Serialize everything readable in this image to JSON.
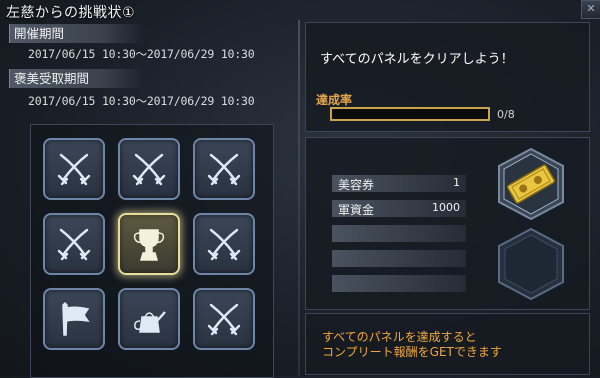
{
  "window": {
    "title": "左慈からの挑戦状①",
    "close_label": "✕"
  },
  "event_period": {
    "label": "開催期間",
    "dates": "2017/06/15 10:30～2017/06/29 10:30"
  },
  "reward_period": {
    "label": "褒美受取期間",
    "dates": "2017/06/15 10:30～2017/06/29 10:30"
  },
  "panels": [
    {
      "icon": "crossed-swords-icon"
    },
    {
      "icon": "crossed-swords-icon"
    },
    {
      "icon": "crossed-swords-icon"
    },
    {
      "icon": "crossed-swords-icon"
    },
    {
      "icon": "trophy-icon",
      "highlighted": true
    },
    {
      "icon": "crossed-swords-icon"
    },
    {
      "icon": "flag-icon"
    },
    {
      "icon": "watering-can-icon"
    },
    {
      "icon": "crossed-swords-icon"
    }
  ],
  "mission": {
    "text": "すべてのパネルをクリアしよう！"
  },
  "progress": {
    "label": "達成率",
    "count": "0/8",
    "fraction": 0
  },
  "rewards": [
    {
      "name": "美容券",
      "qty": "1"
    },
    {
      "name": "軍資金",
      "qty": "1000"
    },
    {
      "name": "",
      "qty": ""
    },
    {
      "name": "",
      "qty": ""
    },
    {
      "name": "",
      "qty": ""
    }
  ],
  "reward_slots": [
    {
      "icon": "gold-ticket-icon",
      "filled": true
    },
    {
      "icon": "empty-slot-icon",
      "filled": false
    }
  ],
  "footer": {
    "line1": "すべてのパネルを達成すると",
    "line2": "コンプリート報酬をGETできます"
  },
  "colors": {
    "accent_gold": "#e6c060",
    "footer_text": "#f0a63c"
  }
}
